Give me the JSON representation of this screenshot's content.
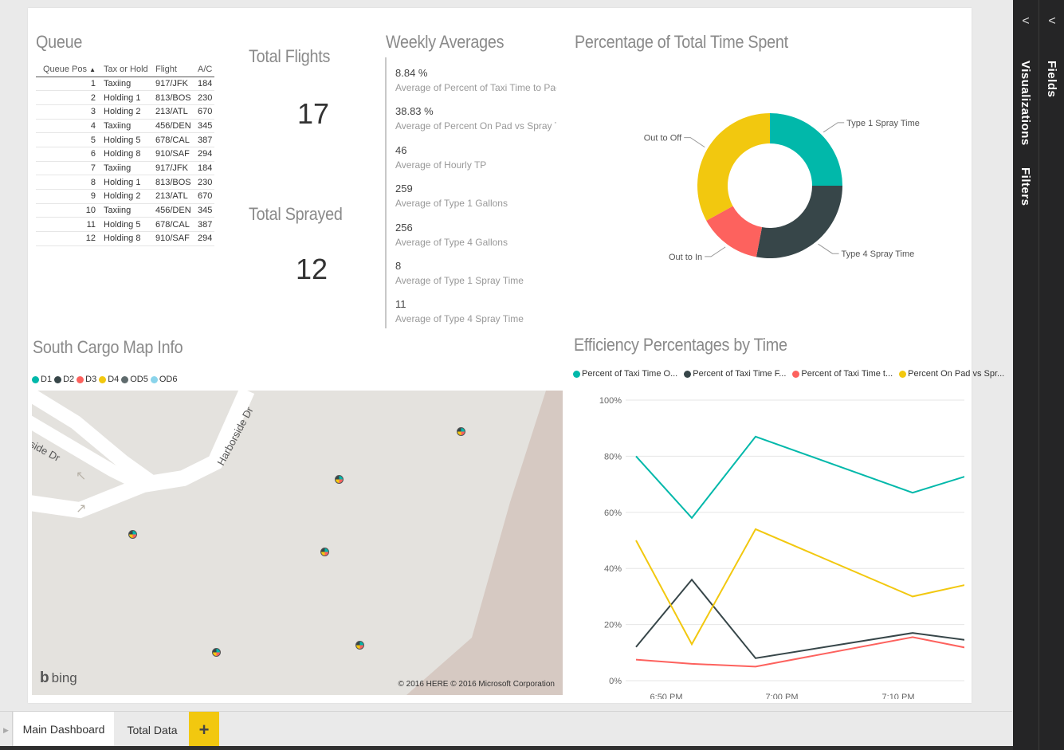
{
  "queue": {
    "title": "Queue",
    "headers": [
      "Queue Pos",
      "Tax or Hold",
      "Flight",
      "A/C"
    ],
    "rows": [
      [
        "1",
        "Taxiing",
        "917/JFK",
        "184"
      ],
      [
        "2",
        "Holding 1",
        "813/BOS",
        "230"
      ],
      [
        "3",
        "Holding 2",
        "213/ATL",
        "670"
      ],
      [
        "4",
        "Taxiing",
        "456/DEN",
        "345"
      ],
      [
        "5",
        "Holding 5",
        "678/CAL",
        "387"
      ],
      [
        "6",
        "Holding 8",
        "910/SAF",
        "294"
      ],
      [
        "7",
        "Taxiing",
        "917/JFK",
        "184"
      ],
      [
        "8",
        "Holding 1",
        "813/BOS",
        "230"
      ],
      [
        "9",
        "Holding 2",
        "213/ATL",
        "670"
      ],
      [
        "10",
        "Taxiing",
        "456/DEN",
        "345"
      ],
      [
        "11",
        "Holding 5",
        "678/CAL",
        "387"
      ],
      [
        "12",
        "Holding 8",
        "910/SAF",
        "294"
      ]
    ]
  },
  "total_flights": {
    "title": "Total Flights",
    "value": "17"
  },
  "total_sprayed": {
    "title": "Total Sprayed",
    "value": "12"
  },
  "weekly": {
    "title": "Weekly Averages",
    "items": [
      {
        "value": "8.84 %",
        "label": "Average of Percent of Taxi Time to Pad"
      },
      {
        "value": "38.83 %",
        "label": "Average of Percent On Pad vs Spray T..."
      },
      {
        "value": "46",
        "label": "Average of Hourly TP"
      },
      {
        "value": "259",
        "label": "Average of Type 1 Gallons"
      },
      {
        "value": "256",
        "label": "Average of Type 4 Gallons"
      },
      {
        "value": "8",
        "label": "Average of Type 1 Spray Time"
      },
      {
        "value": "11",
        "label": "Average of Type 4 Spray Time"
      }
    ]
  },
  "map": {
    "title": "South Cargo Map Info",
    "legend": [
      {
        "label": "D1",
        "color": "#01b8aa"
      },
      {
        "label": "D2",
        "color": "#374649"
      },
      {
        "label": "D3",
        "color": "#fd625e"
      },
      {
        "label": "D4",
        "color": "#f2c80f"
      },
      {
        "label": "OD5",
        "color": "#5f6b6d"
      },
      {
        "label": "OD6",
        "color": "#8ad4eb"
      }
    ],
    "street1": "Harborside Dr",
    "street2": "side Dr",
    "credit": "© 2016 HERE    © 2016 Microsoft Corporation",
    "logo": "bing"
  },
  "tabs": {
    "items": [
      "Main Dashboard",
      "Total Data"
    ],
    "add": "+"
  },
  "side": {
    "visualizations": "Visualizations",
    "filters": "Filters",
    "fields": "Fields"
  },
  "chart_data": [
    {
      "type": "donut",
      "title": "Percentage of Total Time Spent",
      "categories": [
        "Type 1 Spray Time",
        "Type 4 Spray Time",
        "Out to In",
        "Out to Off"
      ],
      "values": [
        25,
        28,
        14,
        33
      ],
      "colors": [
        "#01b8aa",
        "#374649",
        "#fd625e",
        "#f2c80f"
      ]
    },
    {
      "type": "line",
      "title": "Efficiency Percentages by Time",
      "x": [
        "6:45 PM",
        "6:52 PM",
        "6:58 PM",
        "7:10 PM",
        "7:13 PM"
      ],
      "xticks": [
        "6:50 PM",
        "7:00 PM",
        "7:10 PM"
      ],
      "yticks": [
        "0%",
        "20%",
        "40%",
        "60%",
        "80%",
        "100%"
      ],
      "ylim": [
        0,
        100
      ],
      "series": [
        {
          "name": "Percent of Taxi Time O...",
          "color": "#01b8aa",
          "values": [
            80,
            58,
            87,
            67,
            74
          ]
        },
        {
          "name": "Percent of Taxi Time F...",
          "color": "#374649",
          "values": [
            12,
            36,
            8,
            17,
            14
          ]
        },
        {
          "name": "Percent of Taxi Time t...",
          "color": "#fd625e",
          "values": [
            7.5,
            6,
            5,
            15.5,
            11
          ]
        },
        {
          "name": "Percent On Pad vs Spr...",
          "color": "#f2c80f",
          "values": [
            50,
            13,
            54,
            30,
            35
          ]
        }
      ]
    }
  ]
}
